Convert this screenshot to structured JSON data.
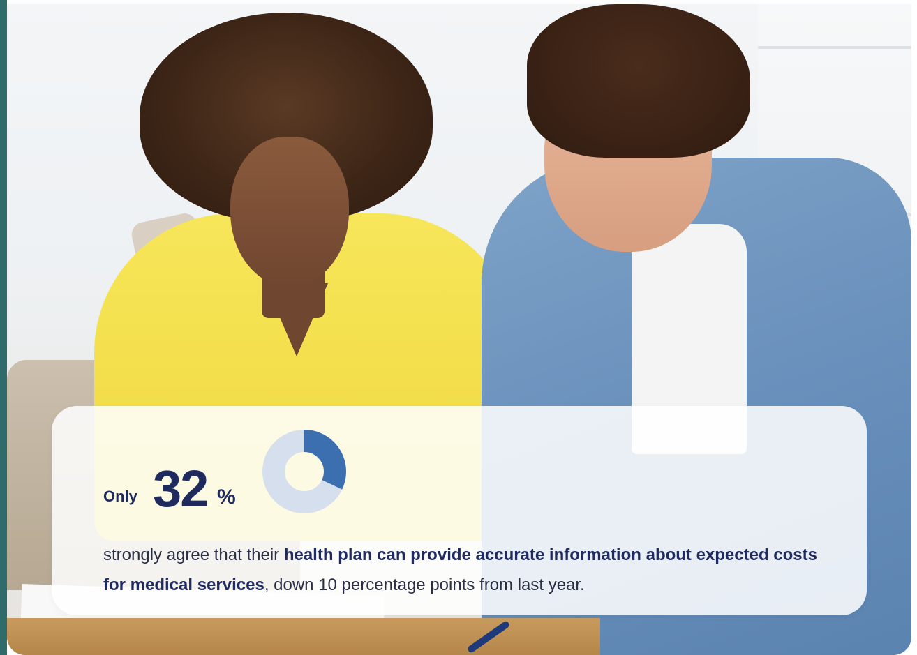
{
  "stat": {
    "prefix": "Only",
    "number": "32",
    "suffix": "%",
    "fraction": 0.32,
    "text_before": "strongly agree that their ",
    "text_bold": "health plan can provide accurate information about expected costs for medical services",
    "text_after": ", down 10 percentage points from last year."
  },
  "colors": {
    "accent": "#3b6fb0",
    "donut_track": "#d5dfee",
    "navy": "#1f2a5e",
    "rail": "#2f6b6a"
  },
  "image": {
    "alt_icon": "people-reviewing-bills-photo"
  }
}
